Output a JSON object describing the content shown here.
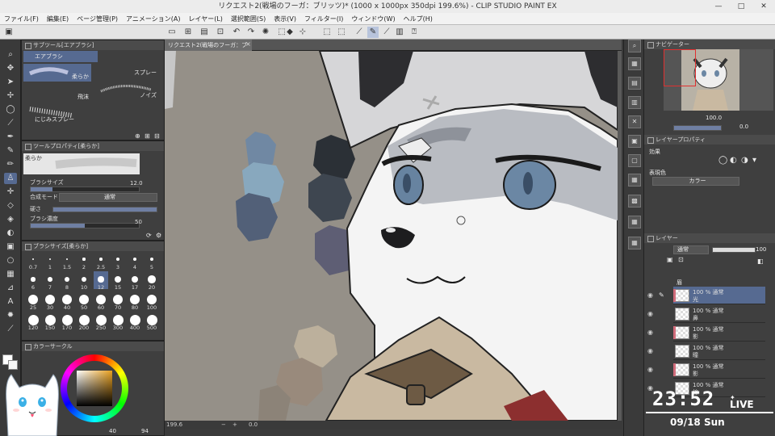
{
  "window": {
    "title": "リクエスト2(戦場のフーガ：ブリッツ)* (1000 x 1000px 350dpi 199.6%)  - CLIP STUDIO PAINT EX",
    "minimize": "—",
    "maximize": "□",
    "close": "✕"
  },
  "menu": [
    "ファイル(F)",
    "編集(E)",
    "ページ管理(P)",
    "アニメーション(A)",
    "レイヤー(L)",
    "選択範囲(S)",
    "表示(V)",
    "フィルター(I)",
    "ウィンドウ(W)",
    "ヘルプ(H)"
  ],
  "subtool": {
    "header": "サブツール[エアブラシ]",
    "group": "エアブラシ",
    "brushes": [
      "柔らか",
      "スプレー",
      "飛沫",
      "ノイズ",
      "にじみスプレー"
    ]
  },
  "toolprop": {
    "header": "ツールプロパティ[柔らか]",
    "name": "柔らか",
    "size_label": "ブラシサイズ",
    "size_value": "12.0",
    "blend_label": "合成モード",
    "blend_value": "通常",
    "hardness_label": "硬さ",
    "density_label": "ブラシ濃度",
    "density_value": "50",
    "density_level": 0.5
  },
  "brushsize": {
    "header": "ブラシサイズ[柔らか]",
    "sizes": [
      "0.7",
      "1",
      "1.5",
      "2",
      "2.5",
      "3",
      "4",
      "5",
      "6",
      "7",
      "8",
      "10",
      "12",
      "15",
      "17",
      "20",
      "25",
      "30",
      "40",
      "50",
      "60",
      "70",
      "80",
      "100",
      "120",
      "150",
      "170",
      "200",
      "250",
      "300",
      "400",
      "500"
    ]
  },
  "colorcircle": {
    "header": "カラーサークル",
    "readout": "40",
    "readout2": "94"
  },
  "canvas": {
    "tab": "リクエスト2(戦場のフーガ：ブリッツ)*",
    "zoom": "199.6",
    "angle": "0.0"
  },
  "navigator": {
    "header": "ナビゲーター",
    "zoom": "100.0",
    "angle": "0.0"
  },
  "layerprop": {
    "header": "レイヤープロパティ",
    "effect_label": "効果",
    "expression_label": "表現色",
    "expression_value": "カラー"
  },
  "layers": {
    "header": "レイヤー",
    "blend": "通常",
    "opacity": "100",
    "items": [
      {
        "pct": "100 %",
        "mode": "通常",
        "name": "光"
      },
      {
        "pct": "100 %",
        "mode": "通常",
        "name": "鼻"
      },
      {
        "pct": "100 %",
        "mode": "通常",
        "name": "影"
      },
      {
        "pct": "100 %",
        "mode": "通常",
        "name": "瞳"
      },
      {
        "pct": "100 %",
        "mode": "通常",
        "name": "影"
      },
      {
        "pct": "100 %",
        "mode": "通常",
        "name": "線"
      }
    ],
    "top_label": "眉"
  },
  "overlay": {
    "time": "23:52",
    "live": "LIVE",
    "date": "09/18 Sun"
  }
}
